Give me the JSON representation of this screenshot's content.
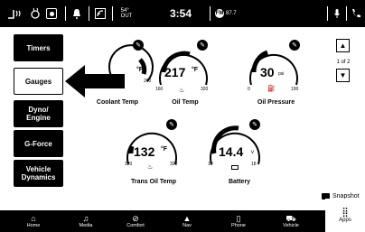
{
  "statusbar": {
    "outside_temp": "54°",
    "outside_label": "OUT",
    "clock": "3:54",
    "radio_freq": "87.7"
  },
  "sidebar": {
    "items": [
      {
        "label": "Timers"
      },
      {
        "label": "Gauges"
      },
      {
        "label": "Dyno/\nEngine"
      },
      {
        "label": "G-Force"
      },
      {
        "label": "Vehicle\nDynamics"
      }
    ]
  },
  "gauges": [
    {
      "name": "Coolant Temp",
      "value": "",
      "unit": "°F",
      "min": "",
      "max": "260"
    },
    {
      "name": "Oil Temp",
      "value": "217",
      "unit": "°F",
      "min": "160",
      "max": "320"
    },
    {
      "name": "Oil Pressure",
      "value": "30",
      "unit": "psi",
      "min": "0",
      "max": "100"
    },
    {
      "name": "Trans Oil Temp",
      "value": "132",
      "unit": "°F",
      "min": "120",
      "max": "320"
    },
    {
      "name": "Battery",
      "value": "14.4",
      "unit": "v",
      "min": "10",
      "max": "18"
    }
  ],
  "pager": {
    "label": "1 of 2"
  },
  "snapshot": {
    "label": "Snapshot"
  },
  "bottombar": {
    "tabs": [
      {
        "label": "Home",
        "icon": "home-icon"
      },
      {
        "label": "Media",
        "icon": "music-icon"
      },
      {
        "label": "Comfort",
        "icon": "comfort-icon"
      },
      {
        "label": "Nav",
        "icon": "nav-icon"
      },
      {
        "label": "Phone",
        "icon": "phone-icon"
      },
      {
        "label": "Vehicle",
        "icon": "vehicle-icon"
      },
      {
        "label": "Apps",
        "icon": "apps-icon"
      }
    ]
  },
  "colors": {
    "bar": "#000000",
    "background": "#ffffff"
  }
}
